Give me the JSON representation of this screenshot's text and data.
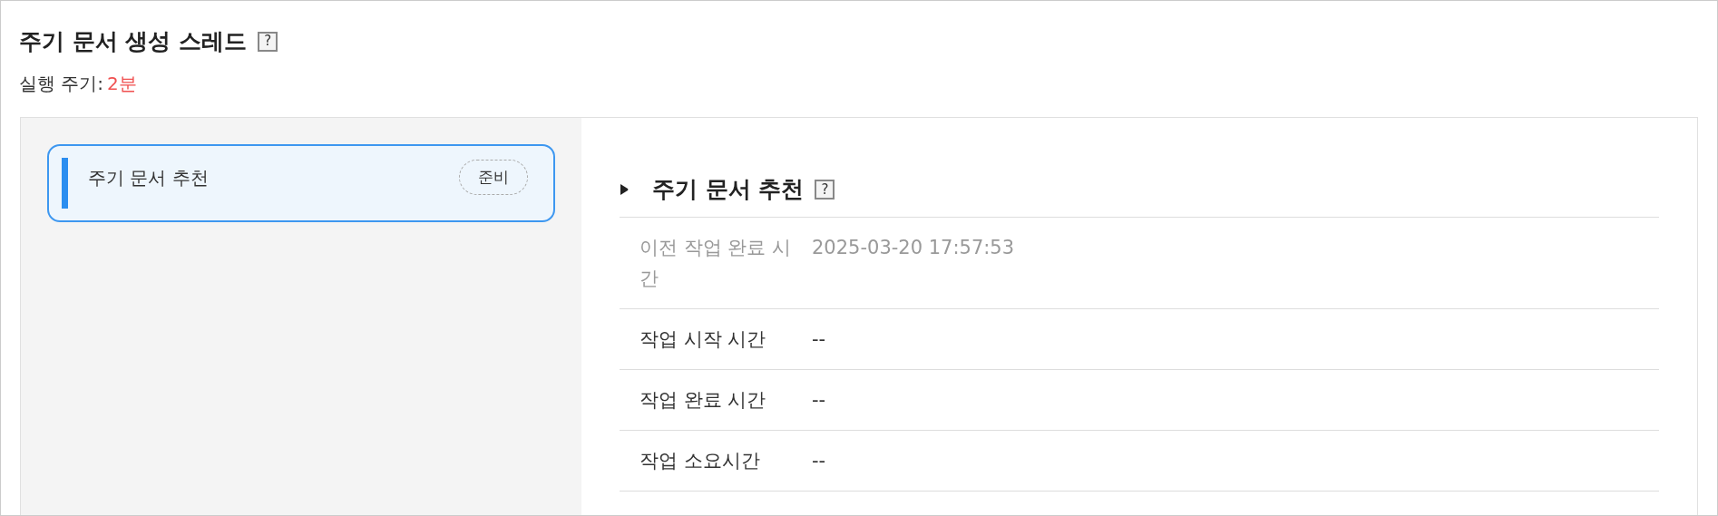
{
  "header": {
    "title": "주기 문서 생성 스레드",
    "help": "?",
    "period_label": "실행 주기:",
    "period_value": "2분"
  },
  "tasks": [
    {
      "name": "주기 문서 추천",
      "status": "준비",
      "selected": true
    }
  ],
  "detail": {
    "title": "주기 문서 추천",
    "help": "?",
    "rows": [
      {
        "label": "이전 작업 완료 시간",
        "value": "2025-03-20 17:57:53",
        "dimmed": true
      },
      {
        "label": "작업 시작 시간",
        "value": "--",
        "dimmed": false
      },
      {
        "label": "작업 완료 시간",
        "value": "--",
        "dimmed": false
      },
      {
        "label": "작업 소요시간",
        "value": "--",
        "dimmed": false
      }
    ]
  }
}
